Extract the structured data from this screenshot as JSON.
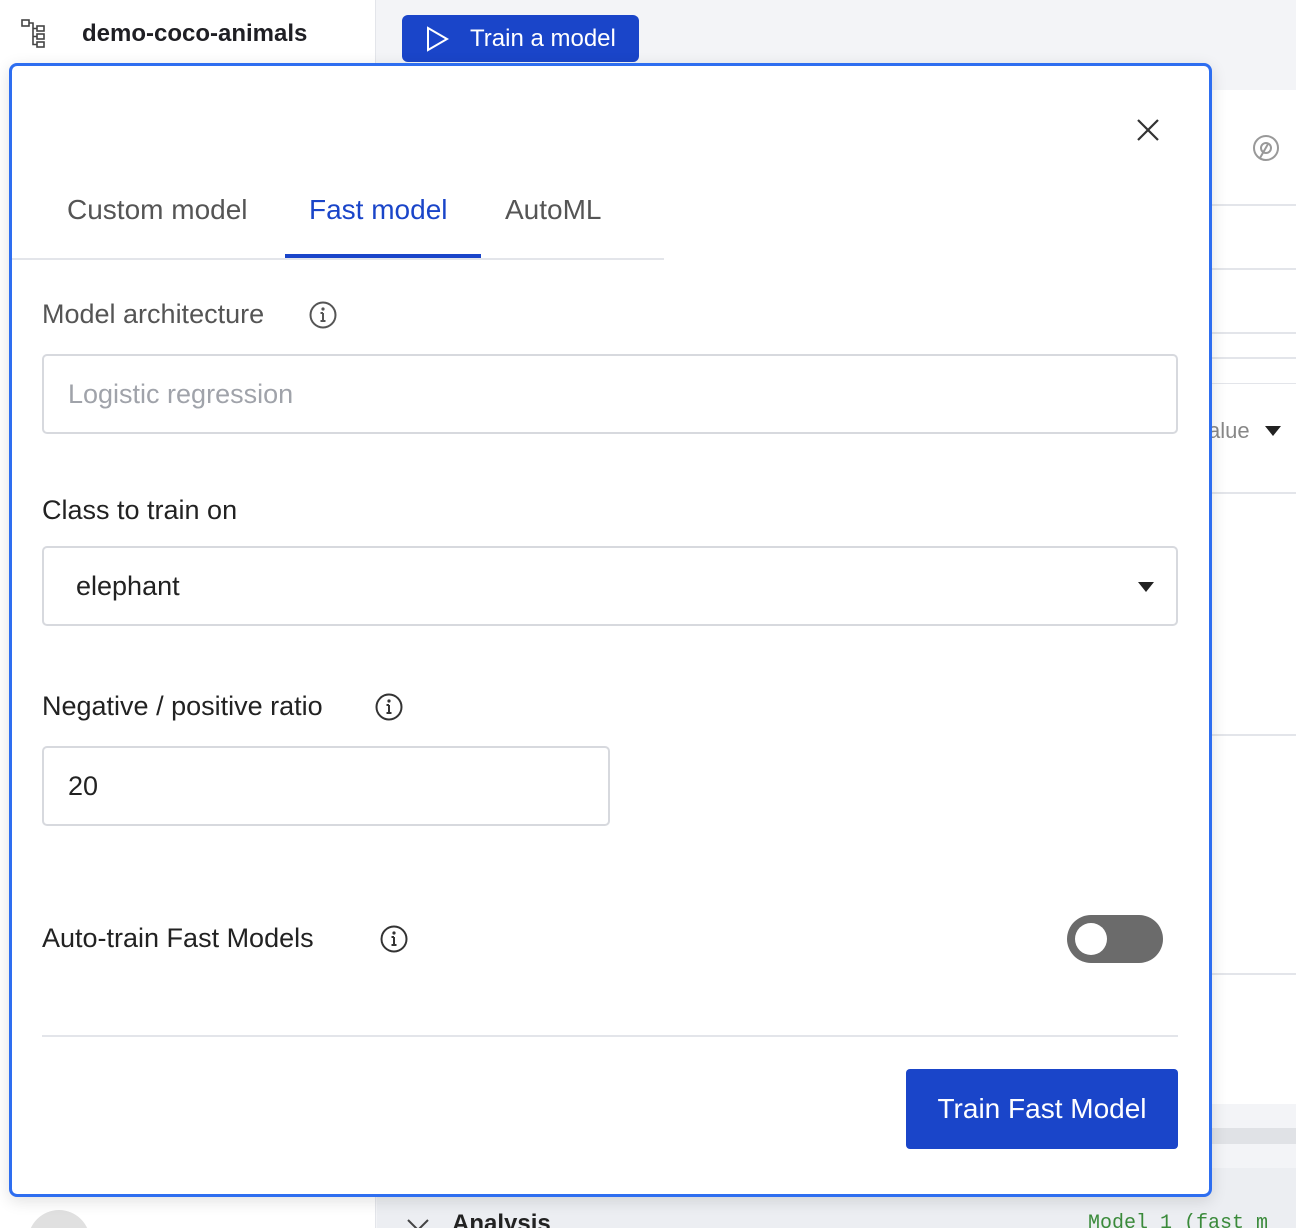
{
  "project": {
    "name": "demo-coco-animals",
    "icon": "hierarchy-icon"
  },
  "toolbar": {
    "train_label": "Train a model",
    "train_icon": "play-icon"
  },
  "background": {
    "sort_value_partial": "alue",
    "section_title": "Analysis",
    "model_text_partial": "Model 1 (fast m"
  },
  "modal": {
    "close_icon": "close-icon",
    "tabs": [
      {
        "label": "Custom model",
        "active": false
      },
      {
        "label": "Fast model",
        "active": true
      },
      {
        "label": "AutoML",
        "active": false
      }
    ],
    "architecture": {
      "label": "Model architecture",
      "placeholder": "Logistic regression"
    },
    "class_field": {
      "label": "Class to train on",
      "value": "elephant"
    },
    "ratio_field": {
      "label": "Negative / positive ratio",
      "value": "20"
    },
    "auto_train": {
      "label": "Auto-train Fast Models",
      "enabled": false
    },
    "submit_label": "Train Fast Model"
  },
  "colors": {
    "accent": "#1a45c9",
    "modal_border": "#2e6ef0",
    "toggle_off": "#6b6b6b"
  }
}
